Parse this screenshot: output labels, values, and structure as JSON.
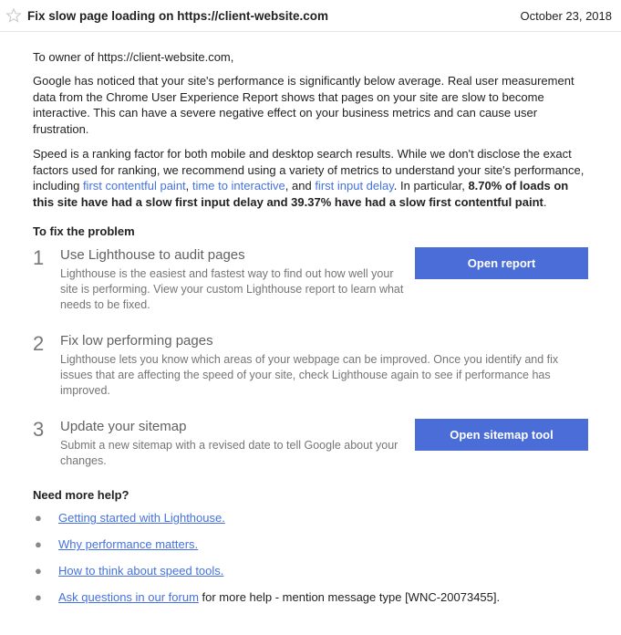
{
  "header": {
    "title": "Fix slow page loading on https://client-website.com",
    "date": "October 23, 2018"
  },
  "salutation": "To owner of https://client-website.com,",
  "para1": "Google has noticed that your site's performance is significantly below average. Real user measurement data from the Chrome User Experience Report shows that pages on your site are slow to become interactive. This can have a severe negative effect on your business metrics and can cause user frustration.",
  "para2": {
    "pre": "Speed is a ranking factor for both mobile and desktop search results. While we don't disclose the exact factors used for ranking, we recommend using a variety of metrics to understand your site's performance, including ",
    "link1": "first contentful paint",
    "sep1": ", ",
    "link2": "time to interactive",
    "sep2": ", and ",
    "link3": "first input delay",
    "post1": ". In particular, ",
    "bold": "8.70% of loads on this site have had a slow first input delay and 39.37% have had a slow first contentful paint",
    "post2": "."
  },
  "fix_header": "To fix the problem",
  "steps": [
    {
      "num": "1",
      "title": "Use Lighthouse to audit pages",
      "desc": "Lighthouse is the easiest and fastest way to find out how well your site is performing. View your custom Lighthouse report to learn what needs to be fixed.",
      "button": "Open report"
    },
    {
      "num": "2",
      "title": "Fix low performing pages",
      "desc": "Lighthouse lets you know which areas of your webpage can be improved. Once you identify and fix issues that are affecting the speed of your site, check Lighthouse again to see if performance has improved."
    },
    {
      "num": "3",
      "title": "Update your sitemap",
      "desc": "Submit a new sitemap with a revised date to tell Google about your changes.",
      "button": "Open sitemap tool"
    }
  ],
  "help_header": "Need more help?",
  "help_links": [
    {
      "text": "Getting started with Lighthouse.",
      "suffix": ""
    },
    {
      "text": "Why performance matters.",
      "suffix": ""
    },
    {
      "text": "How to think about speed tools.",
      "suffix": ""
    },
    {
      "text": "Ask questions in our forum",
      "suffix": " for more help - mention message type [WNC-20073455]."
    }
  ]
}
